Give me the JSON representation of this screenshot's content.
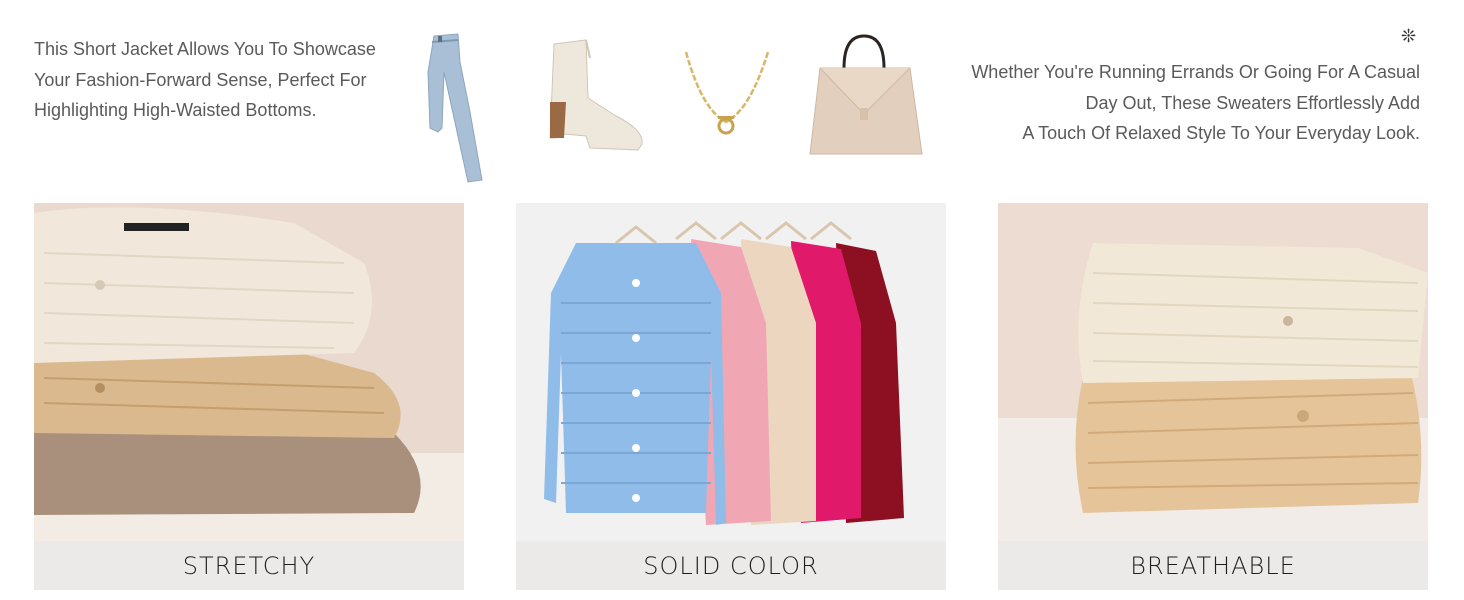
{
  "intro": {
    "left_text": "This Short Jacket Allows You To Showcase Your Fashion-Forward Sense, Perfect For Highlighting High-Waisted Bottoms.",
    "right_line_1": "Whether You're Running Errands Or Going For A Casual",
    "right_line_2": "Day Out, These Sweaters Effortlessly Add",
    "right_line_3": "A Touch Of Relaxed Style To Your Everyday Look."
  },
  "accessories": [
    {
      "name": "jeans-icon"
    },
    {
      "name": "ankle-boot-icon"
    },
    {
      "name": "necklace-icon"
    },
    {
      "name": "handbag-icon"
    }
  ],
  "features": [
    {
      "label": "STRETCHY"
    },
    {
      "label": "SOLID COLOR"
    },
    {
      "label": "BREATHABLE"
    }
  ],
  "colors": {
    "cream": "#f1e8db",
    "camel": "#d9b98d",
    "mocha": "#a8907c",
    "blue": "#8fbce8",
    "pink": "#f0a7b3",
    "beige": "#ecd6c0",
    "fuchsia": "#e0196a",
    "burgundy": "#8c1022"
  }
}
